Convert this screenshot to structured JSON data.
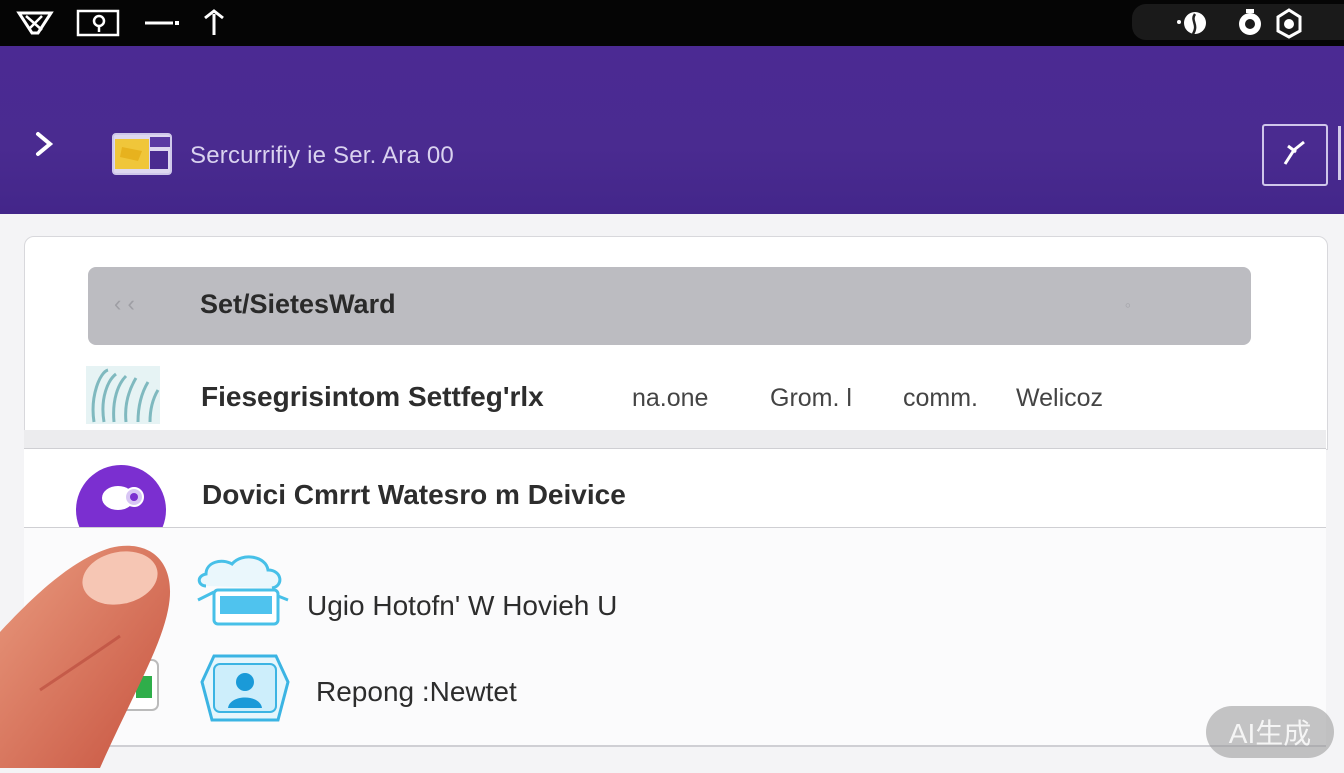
{
  "status_bar": {
    "left_icons": [
      "network-icon",
      "location-icon",
      "minus-icon",
      "upload-arrow-icon"
    ],
    "right_icons": [
      "flame-icon",
      "alarm-icon",
      "settings-icon"
    ]
  },
  "app_bar": {
    "title": "Sercurrifiy ie Ser. Ara 00",
    "back_icon": "chevron-right-icon",
    "card_icon": "security-card-icon",
    "edit_icon": "pencil-icon",
    "background_color": "#4a2b90"
  },
  "search": {
    "label": "Set/SietesWard"
  },
  "rows": [
    {
      "label": "Fiesegrisintom Settfeg'rlx",
      "extras": [
        "na.one",
        "Grom. l",
        "comm.",
        "Welicoz"
      ],
      "icon": "fingerprint-icon"
    },
    {
      "label": "Dovici Cmrrt  Watesro m Deivice",
      "icon": "device-chat-icon"
    },
    {
      "label": "Ugio Hotofn' W Hovieh U",
      "icon": "cloud-device-icon"
    },
    {
      "label": "Repong :Newtet",
      "icon": "user-profile-icon"
    }
  ],
  "watermark": "AI生成"
}
